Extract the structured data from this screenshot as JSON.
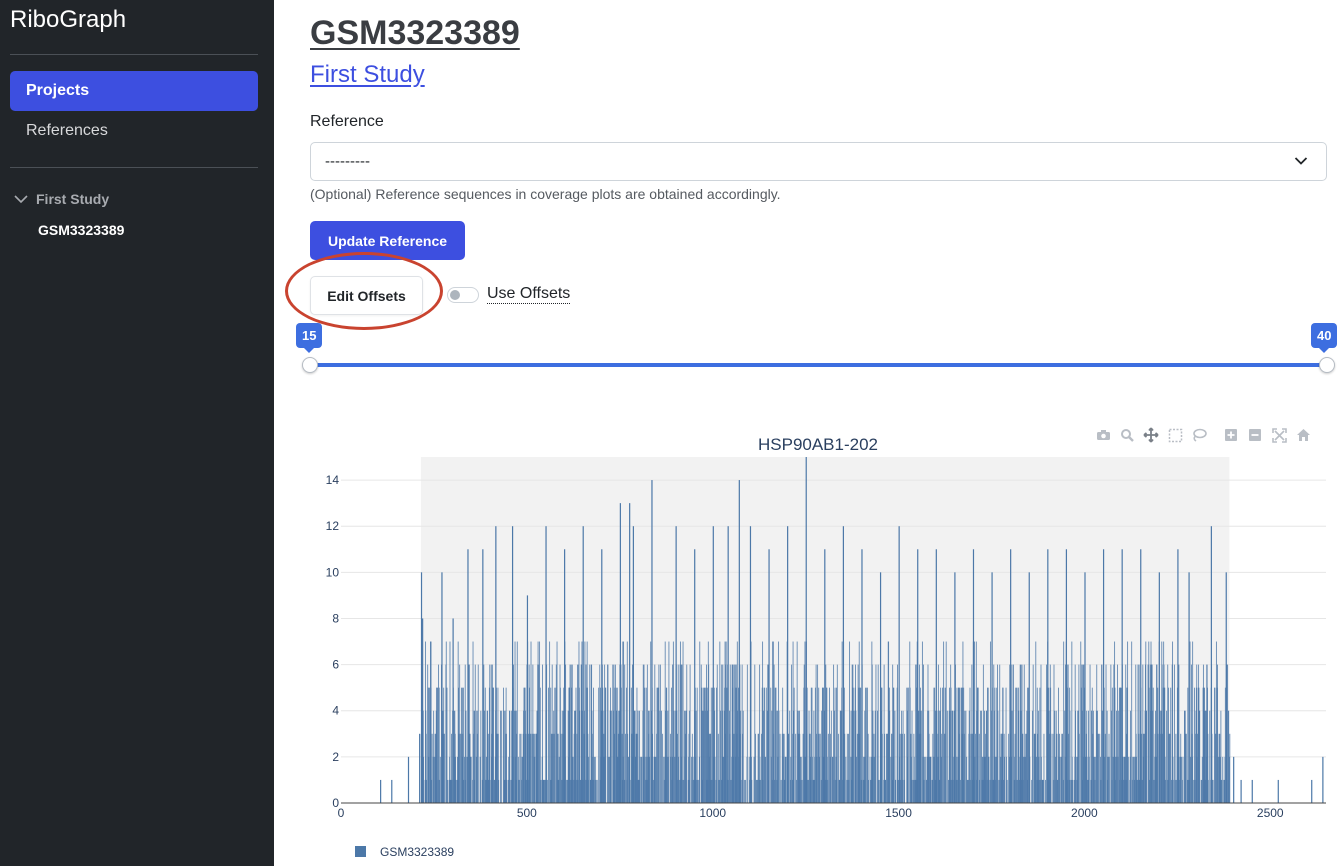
{
  "sidebar": {
    "brand": "RiboGraph",
    "nav": [
      {
        "label": "Projects",
        "active": true
      },
      {
        "label": "References",
        "active": false
      }
    ],
    "tree": {
      "project": "First Study",
      "sample": "GSM3323389"
    }
  },
  "main": {
    "title": "GSM3323389",
    "study_link": "First Study",
    "reference": {
      "label": "Reference",
      "selected": "---------",
      "help": "(Optional) Reference sequences in coverage plots are obtained accordingly."
    },
    "update_button": "Update Reference",
    "edit_offsets_button": "Edit Offsets",
    "use_offsets": {
      "label": "Use Offsets",
      "checked": false
    },
    "range_slider": {
      "min": 15,
      "max": 40,
      "low_label": "15",
      "high_label": "40"
    }
  },
  "modebar": [
    "camera-icon",
    "zoom-icon",
    "pan-icon",
    "box-select-icon",
    "lasso-icon",
    "zoom-in-icon",
    "zoom-out-icon",
    "autoscale-icon",
    "reset-axes-icon"
  ],
  "colors": {
    "accent": "#3d4fe0",
    "bar": "#4c78a8",
    "annotation": "#c9432f",
    "sidebar": "#212529"
  },
  "chart_data": {
    "type": "bar",
    "title": "HSP90AB1-202",
    "xlabel": "",
    "ylabel": "",
    "xlim": [
      0,
      2650
    ],
    "ylim": [
      0,
      15
    ],
    "x_ticks": [
      "0",
      "500",
      "1000",
      "1500",
      "2000",
      "2500"
    ],
    "x_tick_values": [
      0,
      500,
      1000,
      1500,
      2000,
      2500
    ],
    "y_ticks": [
      "0",
      "2",
      "4",
      "6",
      "8",
      "10",
      "12",
      "14"
    ],
    "y_tick_values": [
      0,
      2,
      4,
      6,
      8,
      10,
      12,
      14
    ],
    "cds_region": [
      215,
      2390
    ],
    "grid": true,
    "legend_position": "bottom-left",
    "series": [
      {
        "name": "GSM3323389",
        "peaks": [
          [
            105,
            1
          ],
          [
            135,
            1
          ],
          [
            180,
            2
          ],
          [
            210,
            3
          ],
          [
            215,
            10
          ],
          [
            218,
            8
          ],
          [
            240,
            7
          ],
          [
            270,
            10
          ],
          [
            300,
            8
          ],
          [
            340,
            11
          ],
          [
            380,
            11
          ],
          [
            415,
            12
          ],
          [
            460,
            12
          ],
          [
            500,
            9
          ],
          [
            550,
            12
          ],
          [
            600,
            11
          ],
          [
            650,
            12
          ],
          [
            700,
            11
          ],
          [
            750,
            13
          ],
          [
            775,
            13
          ],
          [
            785,
            12
          ],
          [
            835,
            14
          ],
          [
            900,
            12
          ],
          [
            950,
            11
          ],
          [
            1000,
            12
          ],
          [
            1040,
            12
          ],
          [
            1070,
            14
          ],
          [
            1100,
            12
          ],
          [
            1150,
            11
          ],
          [
            1200,
            12
          ],
          [
            1250,
            15
          ],
          [
            1300,
            11
          ],
          [
            1350,
            12
          ],
          [
            1400,
            11
          ],
          [
            1450,
            10
          ],
          [
            1500,
            12
          ],
          [
            1550,
            11
          ],
          [
            1600,
            11
          ],
          [
            1650,
            10
          ],
          [
            1700,
            11
          ],
          [
            1750,
            10
          ],
          [
            1800,
            11
          ],
          [
            1850,
            10
          ],
          [
            1900,
            11
          ],
          [
            1950,
            11
          ],
          [
            2000,
            10
          ],
          [
            2050,
            11
          ],
          [
            2100,
            11
          ],
          [
            2150,
            11
          ],
          [
            2200,
            10
          ],
          [
            2250,
            11
          ],
          [
            2280,
            10
          ],
          [
            2340,
            12
          ],
          [
            2380,
            10
          ],
          [
            2400,
            2
          ],
          [
            2420,
            1
          ],
          [
            2450,
            1
          ],
          [
            2520,
            1
          ],
          [
            2610,
            1
          ],
          [
            2640,
            2
          ]
        ]
      }
    ]
  }
}
